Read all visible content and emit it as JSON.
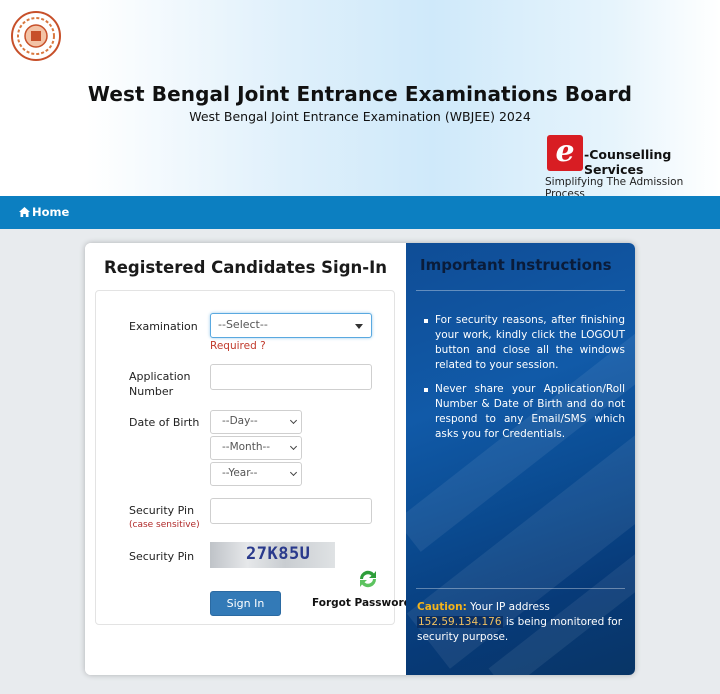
{
  "header": {
    "title": "West Bengal Joint Entrance Examinations Board",
    "subtitle": "West Bengal Joint Entrance Examination (WBJEE) 2024",
    "brand_letter": "e",
    "brand_name": "-Counselling Services",
    "brand_tagline": "Simplifying The Admission Process"
  },
  "nav": {
    "home": "Home"
  },
  "signin": {
    "title": "Registered Candidates Sign-In",
    "exam_label": "Examination",
    "exam_select": "--Select--",
    "required": "Required ?",
    "app_label": "Application Number",
    "dob_label": "Date of Birth",
    "day": "--Day--",
    "month": "--Month--",
    "year": "--Year--",
    "pin_label": "Security Pin",
    "pin_note": "(case sensitive)",
    "captcha_label": "Security Pin",
    "captcha": "27K85U",
    "signin_button": "Sign In",
    "forgot": "Forgot Password ?"
  },
  "instructions": {
    "title": "Important Instructions",
    "items": [
      "For security reasons, after finishing your work, kindly click the LOGOUT button and close all the windows related to your session.",
      "Never share your Application/Roll Number & Date of Birth and do not respond to any Email/SMS which asks you for Credentials."
    ],
    "caution_label": "Caution:",
    "caution_pre": "Your IP address",
    "ip": "152.59.134.176",
    "caution_post": "is being monitored for security purpose."
  },
  "colors": {
    "nav": "#0c7fc1",
    "button": "#337ab7",
    "panel": "#0f4d96",
    "brand": "#d81d23"
  }
}
